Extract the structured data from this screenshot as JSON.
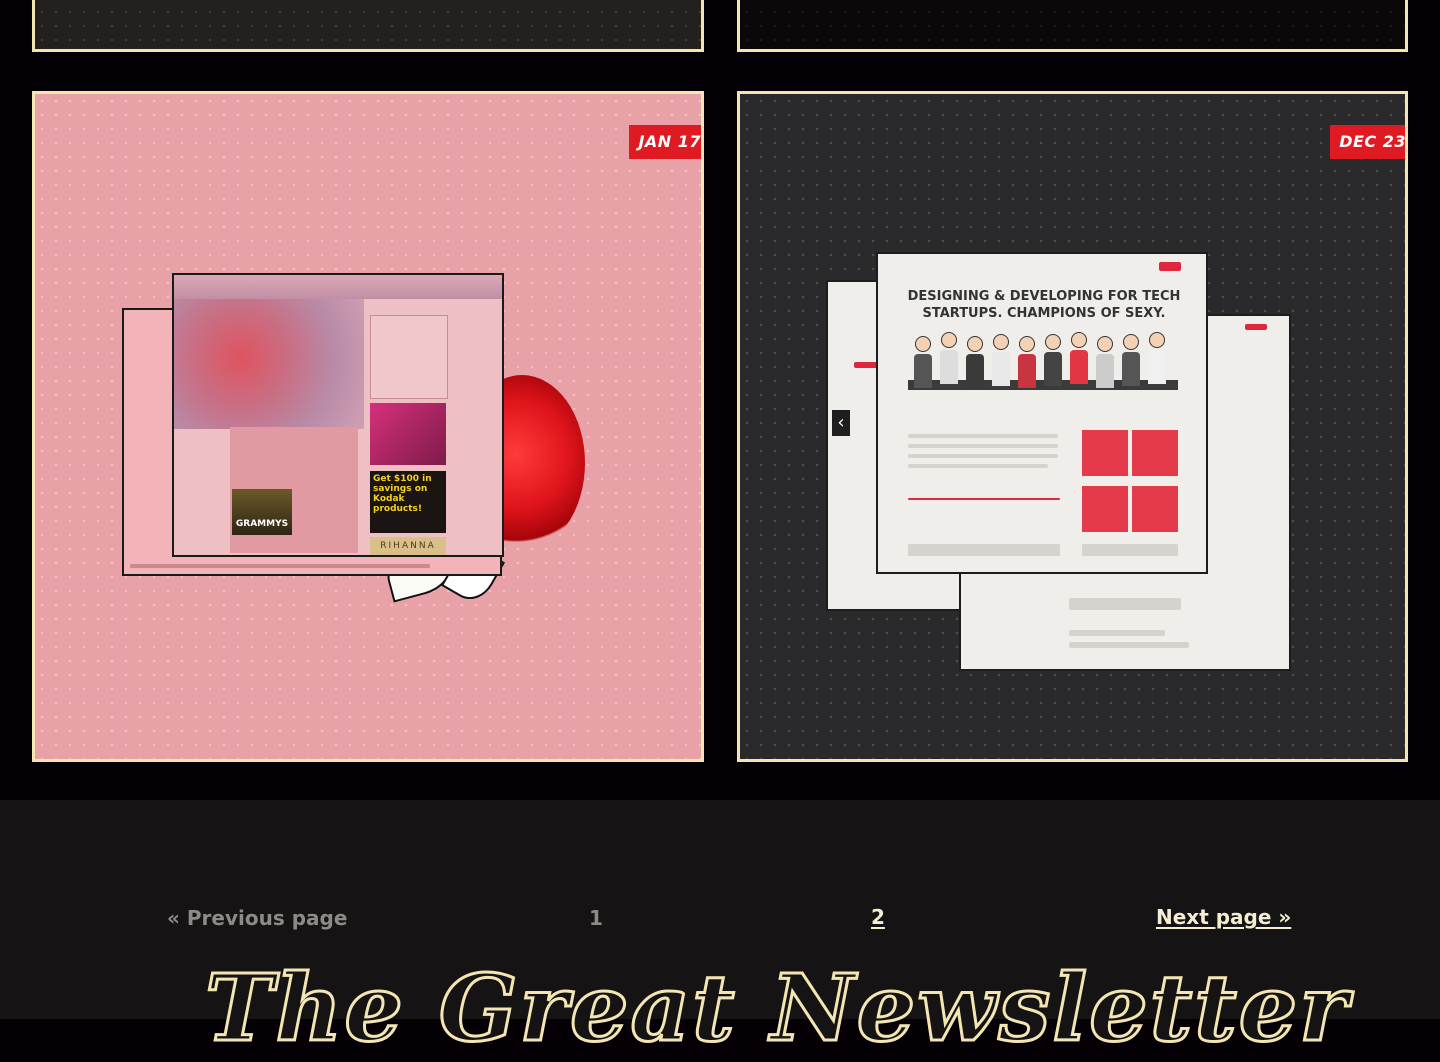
{
  "posts": [
    {
      "date": "JAN 17",
      "theme": "pink",
      "preview": "rihanna-site-screenshot",
      "preview_text": [
        "GRAMMYS",
        "Get $100 in savings on Kodak products!",
        "RIHANNA"
      ]
    },
    {
      "date": "DEC 23",
      "theme": "dark-grey",
      "preview": "hybrid-site-screenshot",
      "preview_text": [
        "DESIGNING & DEVELOPING FOR TECH STARTUPS. CHAMPIONS OF SEXY."
      ]
    }
  ],
  "pagination": {
    "previous_label": "« Previous page",
    "pages": [
      "1",
      "2"
    ],
    "current_page": "2",
    "next_label": "Next page »"
  },
  "masthead": {
    "title": "The Great Newsletter"
  },
  "colors": {
    "card_border": "#f3e6b3",
    "badge": "#e01a22",
    "page_bg": "#050005",
    "footer_bg": "#151313"
  }
}
